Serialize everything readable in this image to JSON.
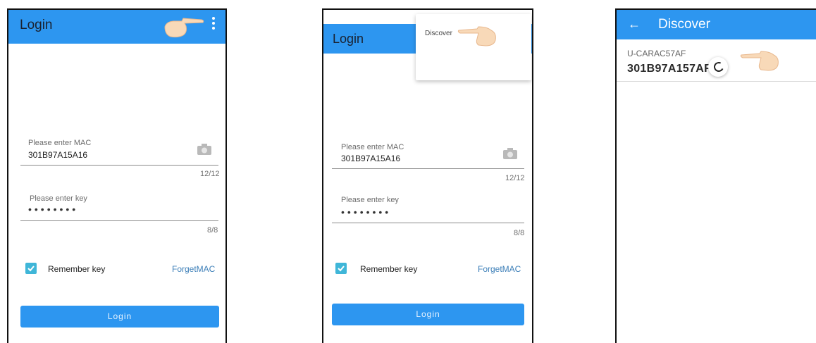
{
  "colors": {
    "appbar": "#2d96f0",
    "accent": "#3fb6d8",
    "link": "#3d7fb8"
  },
  "login_screen": {
    "title": "Login",
    "mac_label": "Please enter MAC",
    "mac_value": "301B97A15A16",
    "mac_counter": "12/12",
    "key_label": "Please enter key",
    "key_value": "••••••••",
    "key_counter": "8/8",
    "remember_label": "Remember key",
    "forget_link": "ForgetMAC",
    "login_button": "Login"
  },
  "menu": {
    "items": [
      {
        "label": "Discover"
      }
    ]
  },
  "discover_screen": {
    "title": "Discover",
    "devices": [
      {
        "name": "U-CARAC57AF",
        "mac": "301B97A157AF"
      }
    ]
  },
  "icons": [
    "more-vert-icon",
    "camera-icon",
    "check-icon",
    "back-arrow-icon",
    "loading-spinner-icon",
    "pointing-hand-icon"
  ]
}
